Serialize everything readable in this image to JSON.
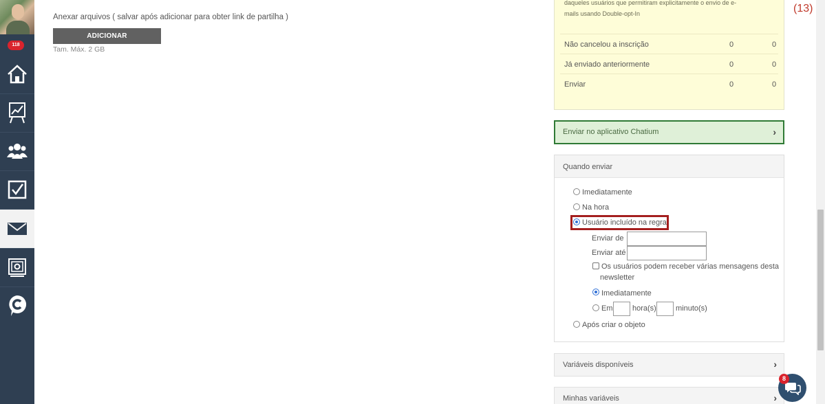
{
  "sidebar": {
    "badge": "118",
    "items": [
      {
        "icon": "home-icon"
      },
      {
        "icon": "chart-board-icon"
      },
      {
        "icon": "users-icon"
      },
      {
        "icon": "checkbox-icon"
      },
      {
        "icon": "mail-icon",
        "active": true
      },
      {
        "icon": "monitor-settings-icon"
      },
      {
        "icon": "chatium-icon"
      }
    ]
  },
  "attach": {
    "label": "Anexar arquivos ( salvar após adicionar para obter link de partilha )",
    "button": "ADICIONAR",
    "max_size": "Tam. Máx. 2 GB"
  },
  "stats": {
    "note": "daqueles usuários que permitiram explicitamente o envio de e-mails usando Double-opt-In",
    "rows": [
      {
        "label": "Não cancelou a inscrição",
        "v1": "0",
        "v2": "0"
      },
      {
        "label": "Já enviado anteriormente",
        "v1": "0",
        "v2": "0"
      },
      {
        "label": "Enviar",
        "v1": "0",
        "v2": "0"
      }
    ]
  },
  "counter": "(13)",
  "chatium_section": {
    "label": "Enviar no aplicativo Chatium"
  },
  "when": {
    "title": "Quando enviar",
    "options": [
      "Imediatamente",
      "Na hora",
      "Usuário incluído na regra",
      "Após criar o objeto"
    ],
    "selected": "Usuário incluído na regra",
    "send_from_label": "Enviar de",
    "send_from_value": "",
    "send_until_label": "Enviar até",
    "send_until_value": "",
    "multi_label": "Os usuários podem receber várias mensagens desta",
    "multi_label_2": "newsletter",
    "multi_checked": false,
    "timing_options": [
      "Imediatamente",
      "Em"
    ],
    "timing_selected": "Imediatamente",
    "hours_label": "hora(s)",
    "hours_value": "",
    "minutes_label": "minuto(s)",
    "minutes_value": ""
  },
  "variables_section": {
    "label": "Variáveis disponíveis"
  },
  "my_variables_section": {
    "label": "Minhas variáveis"
  },
  "chat": {
    "badge": "8"
  }
}
